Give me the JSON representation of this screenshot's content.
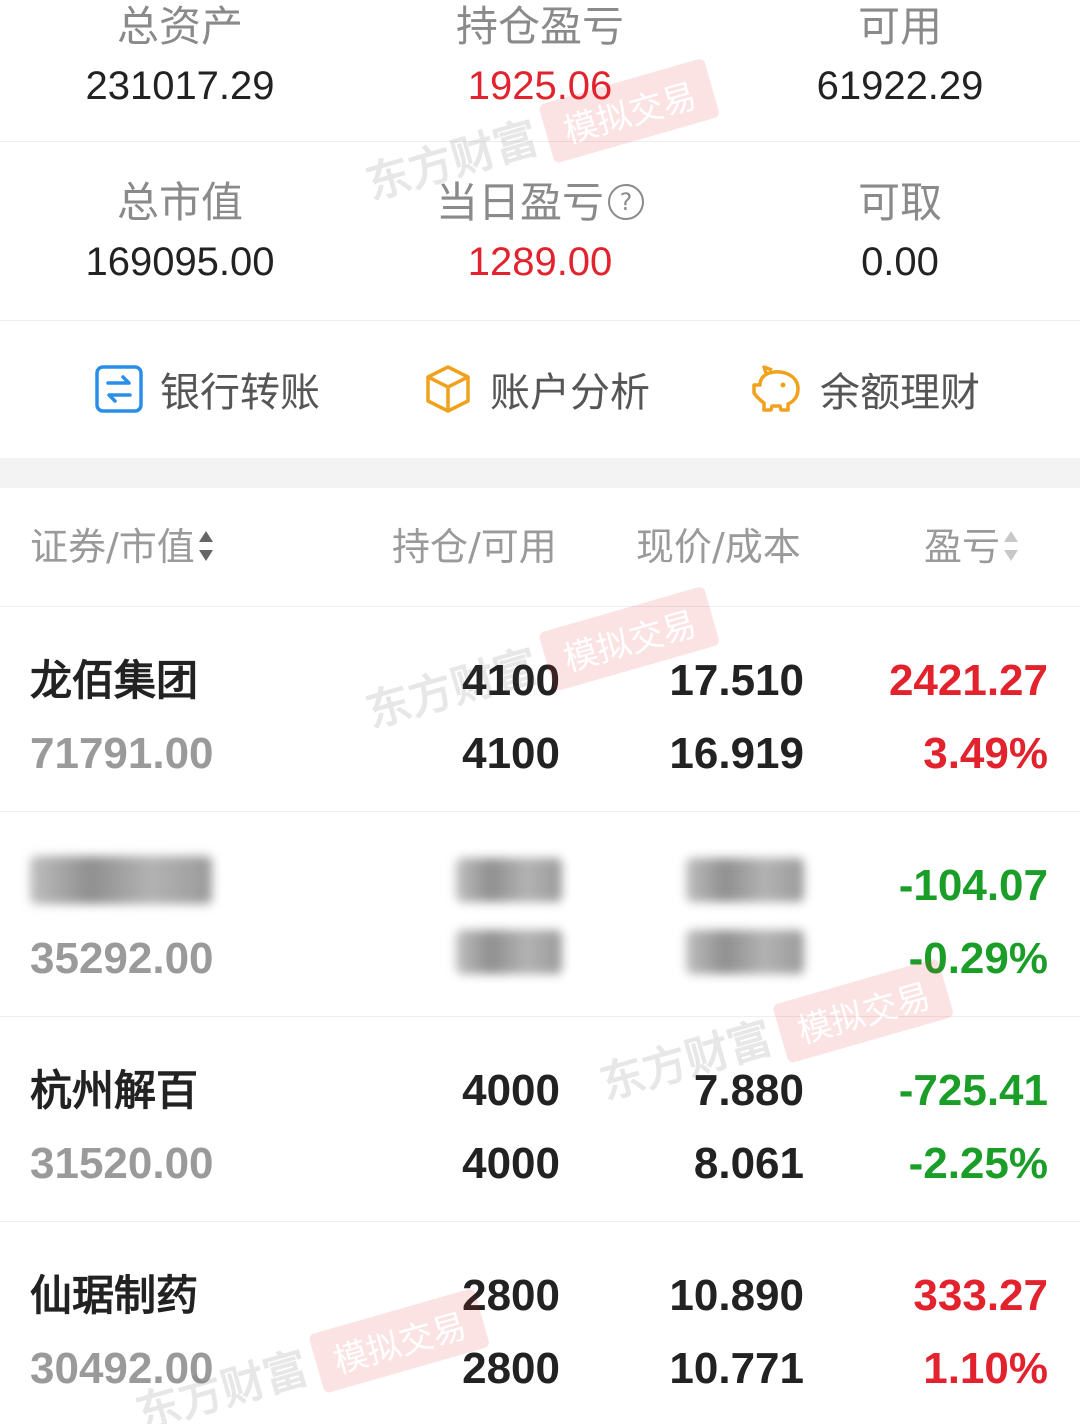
{
  "summary": {
    "total_assets_label": "总资产",
    "total_assets_value": "231017.29",
    "position_pl_label": "持仓盈亏",
    "position_pl_value": "1925.06",
    "available_label": "可用",
    "available_value": "61922.29",
    "market_value_label": "总市值",
    "market_value_value": "169095.00",
    "daily_pl_label": "当日盈亏",
    "daily_pl_value": "1289.00",
    "withdrawable_label": "可取",
    "withdrawable_value": "0.00",
    "info_glyph": "?"
  },
  "actions": {
    "bank_transfer": "银行转账",
    "account_analysis": "账户分析",
    "balance_finance": "余额理财"
  },
  "table": {
    "headers": {
      "security": "证券/市值",
      "holding": "持仓/可用",
      "price": "现价/成本",
      "pl": "盈亏"
    },
    "rows": [
      {
        "name": "龙佰集团",
        "market_value": "71791.00",
        "holding": "4100",
        "available": "4100",
        "price": "17.510",
        "cost": "16.919",
        "pl": "2421.27",
        "pl_pct": "3.49%",
        "status": "profit"
      },
      {
        "name": "",
        "market_value": "35292.00",
        "holding": "",
        "available": "",
        "price": "",
        "cost": "",
        "pl": "-104.07",
        "pl_pct": "-0.29%",
        "status": "loss",
        "obscured": true
      },
      {
        "name": "杭州解百",
        "market_value": "31520.00",
        "holding": "4000",
        "available": "4000",
        "price": "7.880",
        "cost": "8.061",
        "pl": "-725.41",
        "pl_pct": "-2.25%",
        "status": "loss"
      },
      {
        "name": "仙琚制药",
        "market_value": "30492.00",
        "holding": "2800",
        "available": "2800",
        "price": "10.890",
        "cost": "10.771",
        "pl": "333.27",
        "pl_pct": "1.10%",
        "status": "profit"
      }
    ]
  },
  "watermark": {
    "brand": "东方财富",
    "tag": "模拟交易"
  },
  "colors": {
    "profit": "#e2222c",
    "loss": "#1a9e28",
    "icon_blue": "#2a8ee8",
    "icon_orange": "#f0a21e"
  },
  "icons": {
    "bank_transfer": "transfer-icon",
    "account_analysis": "cube-icon",
    "balance_finance": "piggy-bank-icon",
    "sort": "sort-icon",
    "info": "info-icon"
  }
}
